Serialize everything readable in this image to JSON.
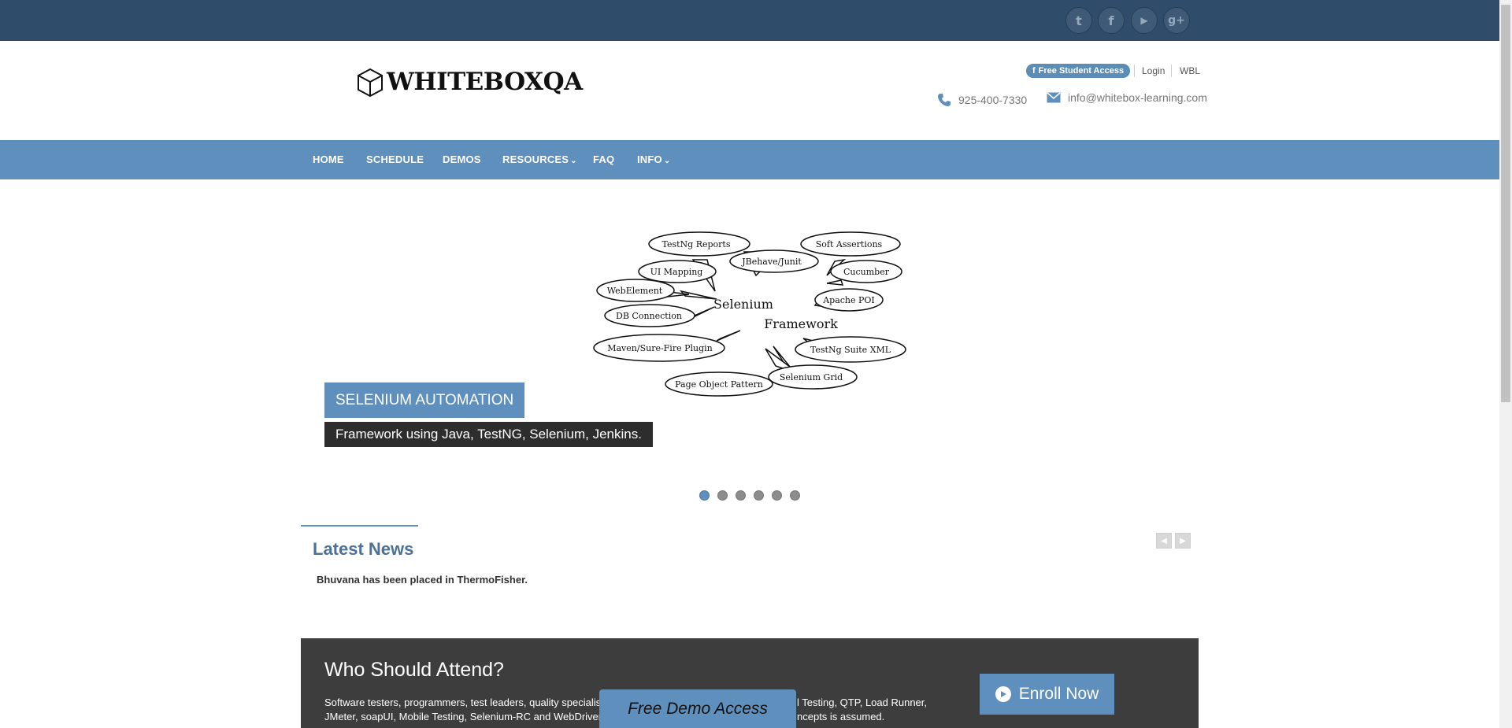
{
  "social": {
    "icons": [
      "twitter-icon",
      "facebook-icon",
      "youtube-icon",
      "google-plus-icon"
    ],
    "glyphs": [
      "t",
      "f",
      "▶",
      "g+"
    ]
  },
  "header": {
    "logo_text": "WHITEBOXQA",
    "free_student_access": "Free Student Access",
    "login": "Login",
    "wbl": "WBL",
    "phone": "925-400-7330",
    "email": "info@whitebox-learning.com"
  },
  "nav": {
    "items": [
      {
        "label": "HOME"
      },
      {
        "label": "SCHEDULE"
      },
      {
        "label": "DEMOS"
      },
      {
        "label": "RESOURCES"
      },
      {
        "label": "FAQ"
      },
      {
        "label": "INFO"
      }
    ],
    "dropdown_glyph": "⌄"
  },
  "slider": {
    "image": {
      "center_words": [
        "Selenium",
        "Framework"
      ],
      "bubbles": [
        "TestNg Reports",
        "Soft Assertions",
        "JBehave/Junit",
        "UI Mapping",
        "Cucumber",
        "WebElement",
        "Apache POI",
        "DB Connection",
        "Maven/Sure-Fire Plugin",
        "TestNg Suite XML",
        "Selenium Grid",
        "Page Object Pattern"
      ]
    },
    "caption_title": "SELENIUM AUTOMATION",
    "caption_sub": "Framework using Java, TestNG, Selenium, Jenkins.",
    "slide_count": 6,
    "active_slide": 1
  },
  "news": {
    "title": "Latest News",
    "item": "Bhuvana has been placed in ThermoFisher.",
    "prev": "◀",
    "next": "▶"
  },
  "attend": {
    "title": "Who Should Attend?",
    "text_line1": "Software testers, programmers, test leaders, quality specialis",
    "text_line1_end": "l Testing, QTP, Load Runner,",
    "text_line2": "JMeter, soapUI, Mobile Testing, Selenium-RC and WebDriver",
    "text_line2_end": "ncepts is assumed.",
    "enroll": "Enroll Now"
  },
  "demo_tab": "Free Demo Access",
  "colors": {
    "topbar": "#2f4d6b",
    "nav": "#5f8fbc",
    "dark_panel": "#3d3d3d",
    "accent": "#5f8fbc"
  }
}
